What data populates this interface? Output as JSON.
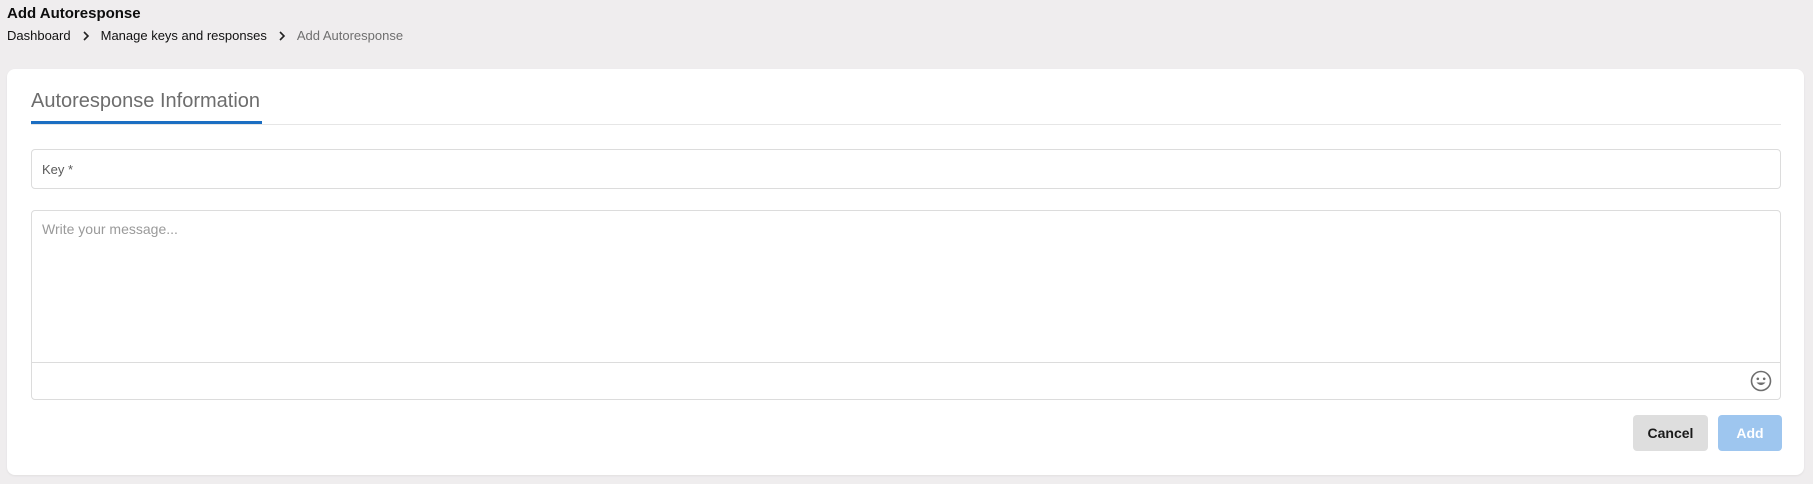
{
  "header": {
    "title": "Add Autoresponse"
  },
  "breadcrumb": {
    "items": [
      {
        "label": "Dashboard"
      },
      {
        "label": "Manage keys and responses"
      },
      {
        "label": "Add Autoresponse"
      }
    ],
    "separator_icon": "chevron-right-icon"
  },
  "form": {
    "tab_label": "Autoresponse Information",
    "key_field": {
      "placeholder": "Key *",
      "value": ""
    },
    "message_field": {
      "placeholder": "Write your message...",
      "value": "",
      "emoji_icon": "smiley-face-icon"
    },
    "buttons": {
      "cancel_label": "Cancel",
      "add_label": "Add"
    }
  },
  "colors": {
    "page_background": "#efedee",
    "tab_underline": "#1b6ec2",
    "add_button": "#9ec6ef",
    "cancel_button": "#dedede"
  }
}
